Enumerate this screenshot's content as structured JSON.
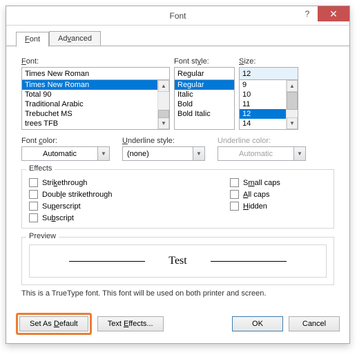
{
  "titlebar": {
    "title": "Font"
  },
  "tabs": {
    "font": "Font",
    "advanced": "Advanced"
  },
  "labels": {
    "font": "Font:",
    "style": "Font style:",
    "size": "Size:",
    "color": "Font color:",
    "uline": "Underline style:",
    "ucolor": "Underline color:"
  },
  "font": {
    "value": "Times New Roman",
    "items": [
      "Times New Roman",
      "Total 90",
      "Traditional Arabic",
      "Trebuchet MS",
      "trees TFB"
    ],
    "selected_index": 0
  },
  "style": {
    "value": "Regular",
    "items": [
      "Regular",
      "Italic",
      "Bold",
      "Bold Italic"
    ],
    "selected_index": 0
  },
  "size": {
    "value": "12",
    "items": [
      "9",
      "10",
      "11",
      "12",
      "14"
    ],
    "selected_index": 3
  },
  "color": {
    "value": "Automatic"
  },
  "uline": {
    "value": "(none)"
  },
  "ucolor": {
    "value": "Automatic"
  },
  "effects": {
    "legend": "Effects",
    "left": [
      "Strikethrough",
      "Double strikethrough",
      "Superscript",
      "Subscript"
    ],
    "right": [
      "Small caps",
      "All caps",
      "Hidden"
    ]
  },
  "preview": {
    "legend": "Preview",
    "sample": "Test",
    "note": "This is a TrueType font. This font will be used on both printer and screen."
  },
  "buttons": {
    "setdefault": "Set As Default",
    "texteffects": "Text Effects...",
    "ok": "OK",
    "cancel": "Cancel"
  }
}
